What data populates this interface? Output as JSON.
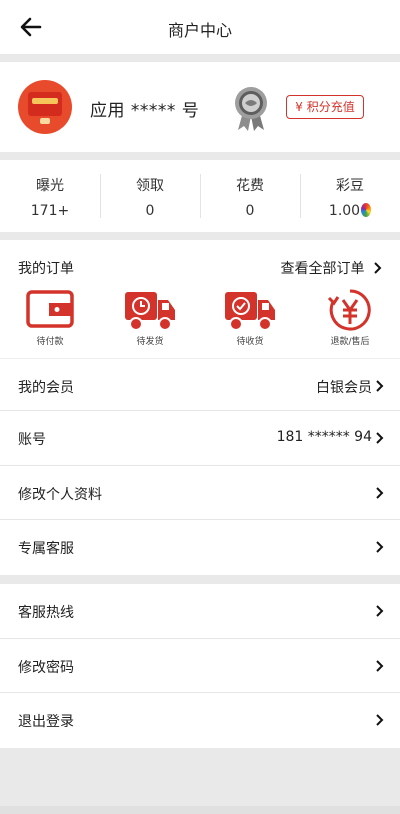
{
  "header": {
    "title": "商户中心"
  },
  "profile": {
    "name": "应用 ***** 号",
    "charge_label": "¥ 积分充值"
  },
  "stats": [
    {
      "label": "曝光",
      "value": "171+"
    },
    {
      "label": "领取",
      "value": "0"
    },
    {
      "label": "花费",
      "value": "0"
    },
    {
      "label": "彩豆",
      "value": "1.00"
    }
  ],
  "orders": {
    "title": "我的订单",
    "view_all": "查看全部订单",
    "items": [
      {
        "label": "待付款",
        "icon": "wallet-icon"
      },
      {
        "label": "待发货",
        "icon": "truck-clock-icon"
      },
      {
        "label": "待收货",
        "icon": "truck-check-icon"
      },
      {
        "label": "退款/售后",
        "icon": "refund-icon"
      }
    ]
  },
  "menu1": [
    {
      "label": "我的会员",
      "value": "白银会员"
    },
    {
      "label": "账号",
      "value": "181 ****** 94"
    },
    {
      "label": "修改个人资料",
      "value": ""
    },
    {
      "label": "专属客服",
      "value": ""
    }
  ],
  "menu2": [
    {
      "label": "客服热线"
    },
    {
      "label": "修改密码"
    },
    {
      "label": "退出登录"
    }
  ],
  "colors": {
    "accent": "#d3332a",
    "background": "#e9e9e9"
  }
}
